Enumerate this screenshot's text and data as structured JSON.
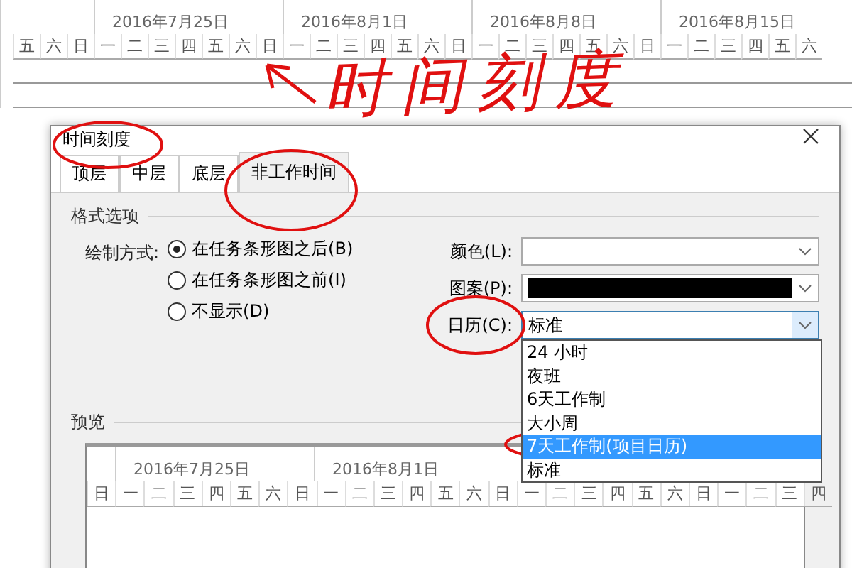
{
  "timescale": {
    "weeks": [
      "2016年7月25日",
      "2016年8月1日",
      "2016年8月8日",
      "2016年8月15日"
    ],
    "days": [
      "五",
      "六",
      "日",
      "一",
      "二",
      "三",
      "四",
      "五",
      "六",
      "日",
      "一",
      "二",
      "三",
      "四",
      "五",
      "六",
      "日",
      "一",
      "二",
      "三",
      "四",
      "五",
      "六",
      "日",
      "一",
      "二",
      "三",
      "四",
      "五",
      "六"
    ]
  },
  "annotation": {
    "text": "时间刻度"
  },
  "dialog": {
    "title": "时间刻度",
    "tabs": [
      {
        "label": "顶层",
        "selected": false
      },
      {
        "label": "中层",
        "selected": false
      },
      {
        "label": "底层",
        "selected": false
      },
      {
        "label": "非工作时间",
        "selected": true
      }
    ],
    "format_group": "格式选项",
    "draw_label": "绘制方式:",
    "draw_options": [
      {
        "label": "在任务条形图之后(B)",
        "selected": true
      },
      {
        "label": "在任务条形图之前(I)",
        "selected": false
      },
      {
        "label": "不显示(D)",
        "selected": false
      }
    ],
    "fields": [
      {
        "label": "颜色(L):",
        "kind": "empty"
      },
      {
        "label": "图案(P):",
        "kind": "swatch",
        "color": "#000000"
      },
      {
        "label": "日历(C):",
        "kind": "open",
        "value": "标准"
      }
    ],
    "calendar_options": [
      {
        "label": "24 小时",
        "selected": false
      },
      {
        "label": "夜班",
        "selected": false
      },
      {
        "label": "6天工作制",
        "selected": false
      },
      {
        "label": "大小周",
        "selected": false
      },
      {
        "label": "7天工作制(项目日历)",
        "selected": true
      },
      {
        "label": "标准",
        "selected": false
      }
    ],
    "preview": {
      "label": "预览",
      "weeks": [
        "2016年7月25日",
        "2016年8月1日"
      ],
      "days": [
        "日",
        "一",
        "二",
        "三",
        "四",
        "五",
        "六",
        "日",
        "一",
        "二",
        "三",
        "四",
        "五",
        "六",
        "日",
        "一",
        "二",
        "三",
        "四",
        "五",
        "六",
        "日",
        "一",
        "二",
        "三",
        "四"
      ]
    }
  }
}
